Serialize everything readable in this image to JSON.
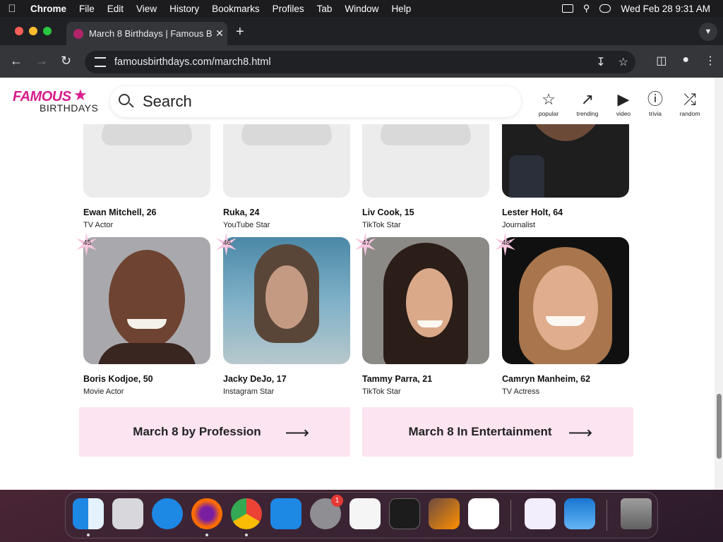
{
  "menubar": {
    "app": "Chrome",
    "items": [
      "File",
      "Edit",
      "View",
      "History",
      "Bookmarks",
      "Profiles",
      "Tab",
      "Window",
      "Help"
    ],
    "datetime": "Wed Feb 28  9:31 AM"
  },
  "browser": {
    "tab_title": "March 8 Birthdays | Famous B",
    "url": "famousbirthdays.com/march8.html"
  },
  "site": {
    "logo_top": "FAMOUS",
    "logo_bottom": "BIRTHDAYS",
    "search_placeholder": "Search",
    "nav": [
      {
        "label": "popular",
        "icon": "star-icon"
      },
      {
        "label": "trending",
        "icon": "trending-icon"
      },
      {
        "label": "video",
        "icon": "video-icon"
      },
      {
        "label": "trivia",
        "icon": "question-icon"
      },
      {
        "label": "random",
        "icon": "shuffle-icon"
      }
    ]
  },
  "people": [
    {
      "rank": "",
      "name": "Ewan Mitchell, 26",
      "job": "TV Actor",
      "photo": "placeholder"
    },
    {
      "rank": "",
      "name": "Ruka, 24",
      "job": "YouTube Star",
      "photo": "placeholder"
    },
    {
      "rank": "",
      "name": "Liv Cook, 15",
      "job": "TikTok Star",
      "photo": "placeholder"
    },
    {
      "rank": "",
      "name": "Lester Holt, 64",
      "job": "Journalist",
      "photo": "portrait"
    },
    {
      "rank": "45",
      "name": "Boris Kodjoe, 50",
      "job": "Movie Actor",
      "photo": "portrait"
    },
    {
      "rank": "46",
      "name": "Jacky DeJo, 17",
      "job": "Instagram Star",
      "photo": "portrait"
    },
    {
      "rank": "47",
      "name": "Tammy Parra, 21",
      "job": "TikTok Star",
      "photo": "portrait"
    },
    {
      "rank": "48",
      "name": "Camryn Manheim, 62",
      "job": "TV Actress",
      "photo": "portrait"
    }
  ],
  "links": {
    "profession": "March 8 by Profession",
    "entertainment": "March 8 In Entertainment"
  },
  "dock": {
    "apps": [
      "Finder",
      "Launchpad",
      "Safari",
      "Firefox",
      "Chrome",
      "App Store",
      "System Settings",
      "TextEdit",
      "Terminal",
      "Instruments",
      "Visual Studio Code",
      "Visual Studio",
      "Weather",
      "Trash"
    ],
    "settings_badge": "1"
  }
}
